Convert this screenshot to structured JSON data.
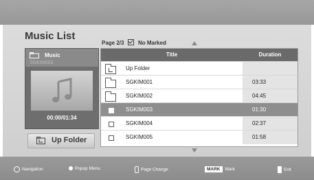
{
  "list": {
    "title": "Music List",
    "page": "Page 2/3",
    "marked": "No Marked",
    "columns": {
      "title": "Title",
      "duration": "Duration"
    },
    "rows": [
      {
        "name": "Up Folder",
        "duration": "",
        "icon": "up-folder-icon",
        "selected": false
      },
      {
        "name": "SGKIM001",
        "duration": "03:33",
        "icon": "folder-icon",
        "selected": false
      },
      {
        "name": "SGKIM002",
        "duration": "04:45",
        "icon": "folder-icon",
        "selected": false
      },
      {
        "name": "SGKIM003",
        "duration": "01:30",
        "icon": "checkbox-icon",
        "selected": true
      },
      {
        "name": "SGKIM004",
        "duration": "02:37",
        "icon": "checkbox-icon",
        "selected": false
      },
      {
        "name": "SGKIM005",
        "duration": "01:58",
        "icon": "checkbox-icon",
        "selected": false
      }
    ]
  },
  "preview": {
    "folder": "Music",
    "file": "SGKIM003",
    "time": "00:00/01:34",
    "art_icon": "music-note-icon"
  },
  "up_folder_button": {
    "label": "Up Folder"
  },
  "footer": {
    "navigation": "Navigation",
    "popup_menu": "Popup Menu",
    "page_change": "Page Change",
    "mark_key": "MARK",
    "mark": "Mark",
    "exit": "Exit"
  }
}
